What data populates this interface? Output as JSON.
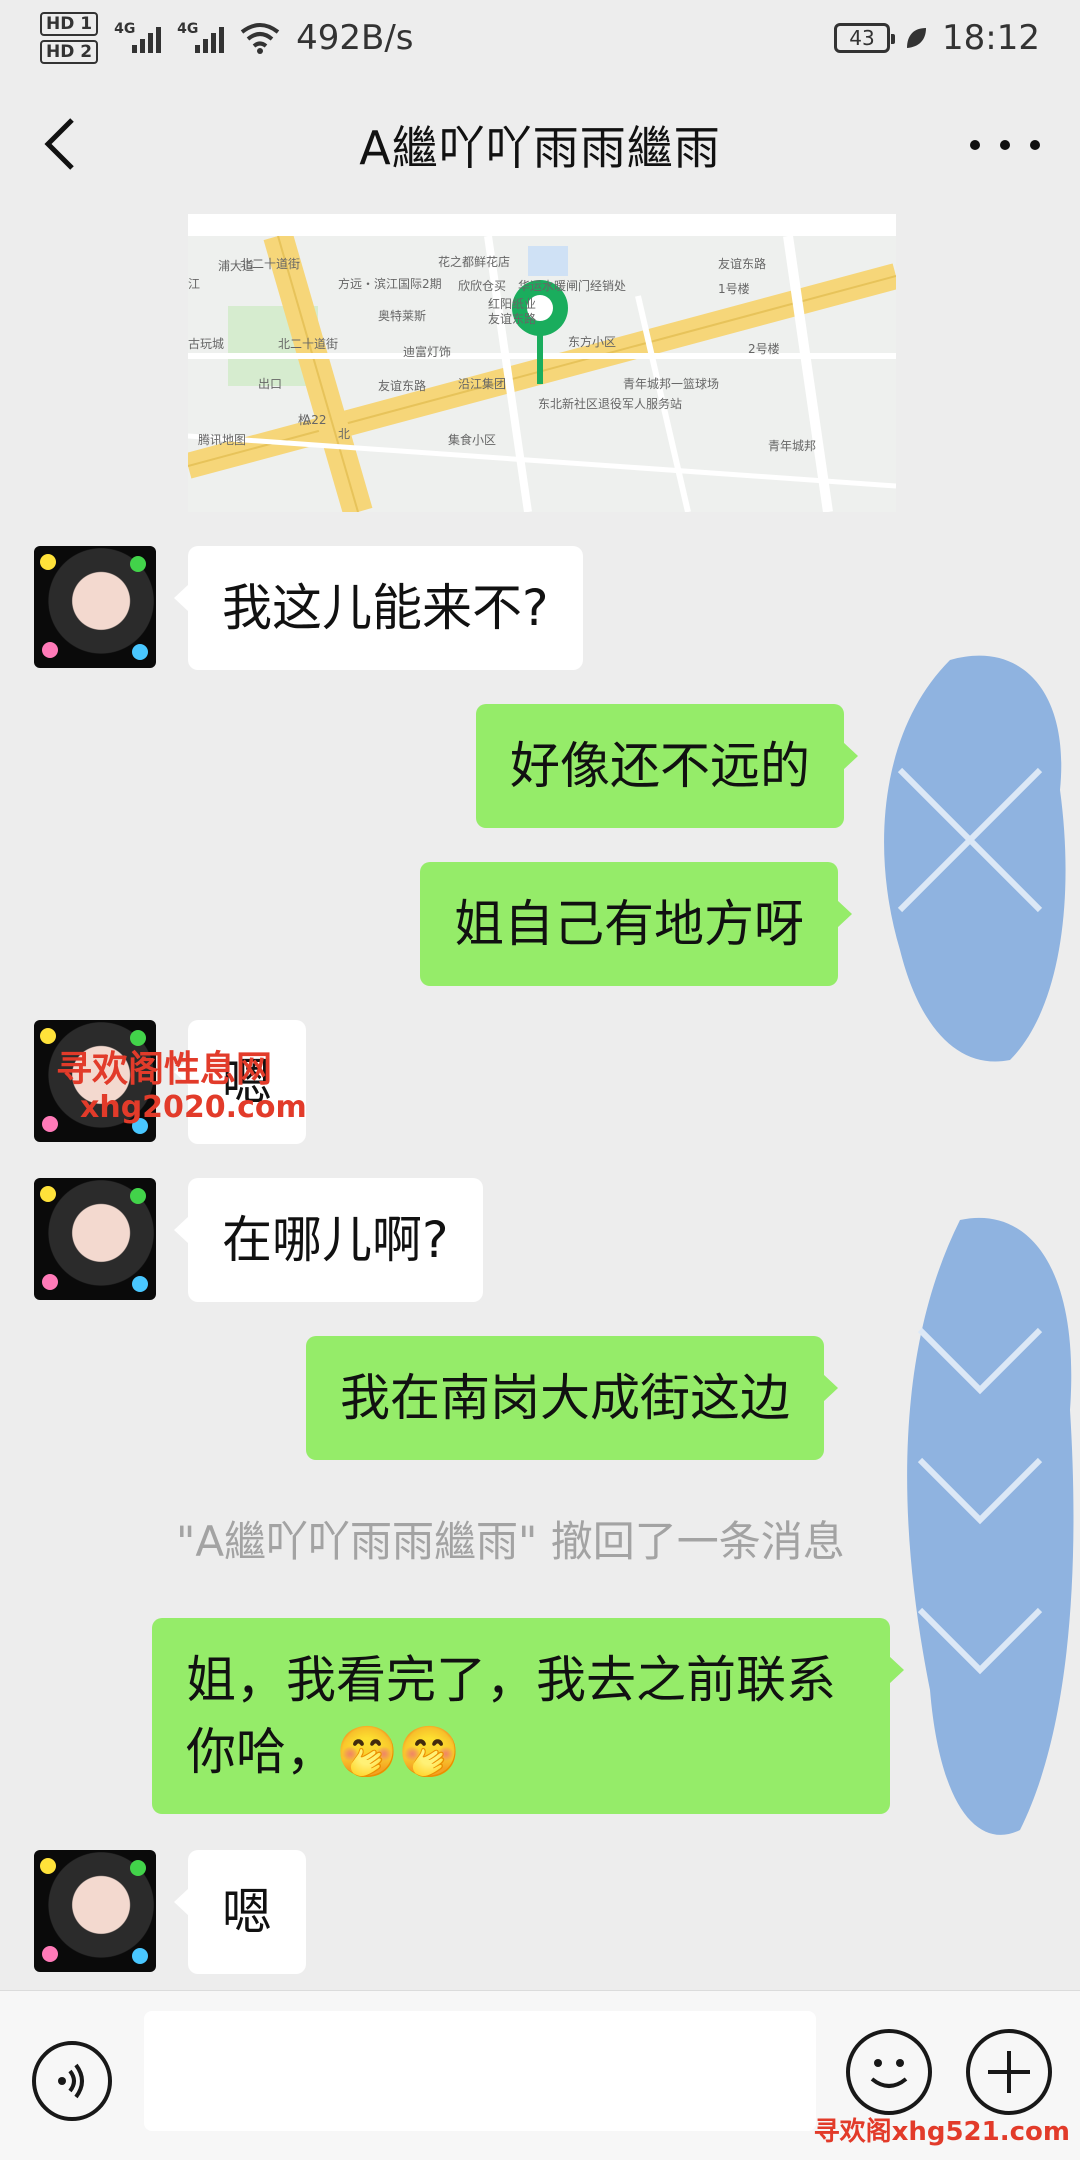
{
  "status_bar": {
    "hd1": "HD 1",
    "hd2": "HD 2",
    "net1": "4G",
    "net2": "4G",
    "speed": "492B/s",
    "battery": "43",
    "time": "18:12"
  },
  "header": {
    "title": "A繼吖吖雨雨繼雨"
  },
  "map": {
    "labels": [
      "花之都鲜花店",
      "方远・滨江国际2期",
      "欣欣仓买",
      "华运水暖闸门经销处",
      "红阳纸业",
      "奥特莱斯",
      "迪富灯饰",
      "东方小区",
      "友谊东路",
      "友谊东路",
      "友谊东路",
      "北二十道街",
      "北二十道街",
      "沿江集团",
      "青年城邦一篮球场",
      "东北新社区退役军人服务站",
      "集食小区",
      "青年城邦",
      "古玩城",
      "1号楼",
      "2号楼",
      "浦大道",
      "松",
      "北",
      "出口",
      "A22",
      "腾讯地图",
      "江"
    ],
    "accent": "#1aad5d"
  },
  "messages": [
    {
      "side": "in",
      "text": "我这儿能来不?"
    },
    {
      "side": "out",
      "text": "好像还不远的"
    },
    {
      "side": "out",
      "text": "姐自己有地方呀"
    },
    {
      "side": "in",
      "text": "嗯"
    },
    {
      "side": "in",
      "text": "在哪儿啊?"
    },
    {
      "side": "out",
      "text": "我在南岗大成街这边"
    },
    {
      "side": "system",
      "text": "\"A繼吖吖雨雨繼雨\" 撤回了一条消息"
    },
    {
      "side": "out",
      "text": "姐，我看完了，我去之前联系你哈，🤭🤭"
    },
    {
      "side": "in",
      "text": "嗯"
    }
  ],
  "watermarks": {
    "top_cn": "寻欢阁性息网",
    "top_url": "xhg2020.com",
    "bottom": "寻欢阁xhg521.com"
  },
  "colors": {
    "background": "#ededed",
    "outgoing_bubble": "#95ec69",
    "incoming_bubble": "#ffffff",
    "censor": "#8fb3e0"
  }
}
